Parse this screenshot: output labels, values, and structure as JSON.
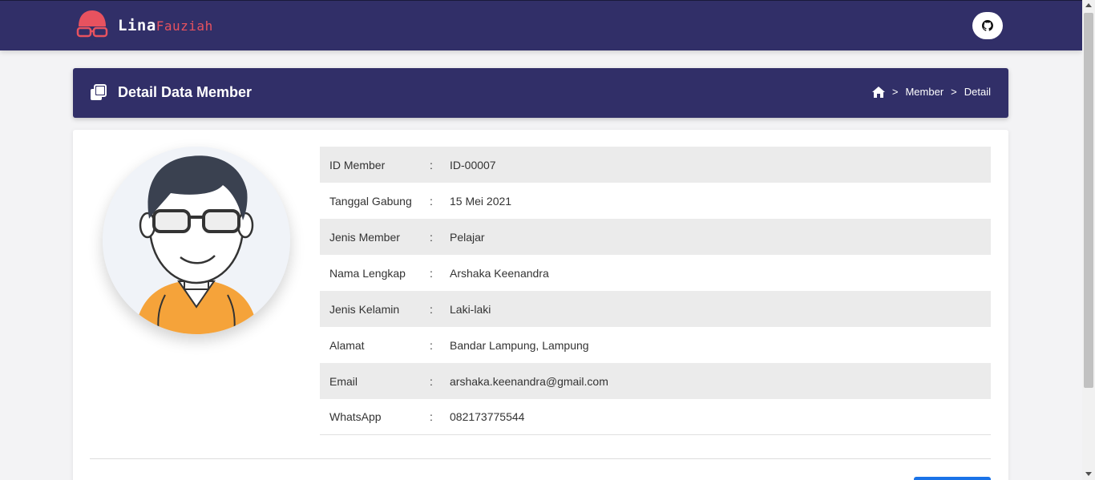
{
  "navbar": {
    "brand_main": "Lina",
    "brand_accent": "Fauziah",
    "logo_icon": "nerd-face-icon",
    "github_icon": "github-icon",
    "colors": {
      "background": "#312f68",
      "accent": "#e8525f"
    }
  },
  "header": {
    "icon": "copy-icon",
    "title": "Detail Data Member",
    "breadcrumb": {
      "home_icon": "home-icon",
      "separator": ">",
      "items": [
        "Member",
        "Detail"
      ]
    }
  },
  "profile": {
    "avatar_icon": "user-avatar-illustration",
    "fields": [
      {
        "label": "ID Member",
        "value": "ID-00007"
      },
      {
        "label": "Tanggal Gabung",
        "value": "15 Mei 2021"
      },
      {
        "label": "Jenis Member",
        "value": "Pelajar"
      },
      {
        "label": "Nama Lengkap",
        "value": "Arshaka Keenandra"
      },
      {
        "label": "Jenis Kelamin",
        "value": "Laki-laki"
      },
      {
        "label": "Alamat",
        "value": "Bandar Lampung, Lampung"
      },
      {
        "label": "Email",
        "value": "arshaka.keenandra@gmail.com"
      },
      {
        "label": "WhatsApp",
        "value": "082173775544"
      }
    ],
    "colon": ":"
  }
}
